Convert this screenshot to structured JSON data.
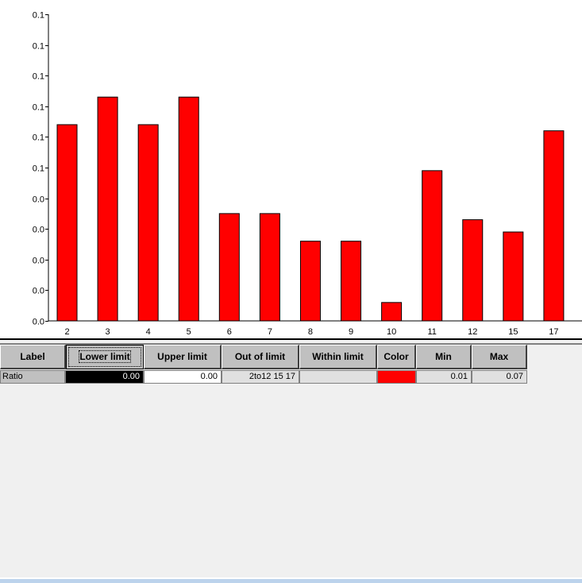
{
  "chart_data": {
    "type": "bar",
    "title": "",
    "xlabel": "",
    "ylabel": "",
    "categories": [
      "2",
      "3",
      "4",
      "5",
      "6",
      "7",
      "8",
      "9",
      "10",
      "11",
      "12",
      "15",
      "17"
    ],
    "values": [
      0.064,
      0.073,
      0.064,
      0.073,
      0.035,
      0.035,
      0.026,
      0.026,
      0.006,
      0.049,
      0.033,
      0.029,
      0.062
    ],
    "ylim": [
      0,
      0.1
    ],
    "y_ticks": [
      0,
      0.01,
      0.02,
      0.03,
      0.04,
      0.05,
      0.06,
      0.07,
      0.08,
      0.09,
      0.1
    ],
    "y_tick_labels": [
      "0.0",
      "0.0",
      "0.0",
      "0.0",
      "0.0",
      "0.1",
      "0.1",
      "0.1",
      "0.1",
      "0.1",
      "0.1"
    ],
    "bar_color": "#ff0000",
    "grid": false,
    "legend": "none"
  },
  "table": {
    "headers": [
      "Label",
      "Lower limit",
      "Upper limit",
      "Out of limit",
      "Within limit",
      "Color",
      "Min",
      "Max"
    ],
    "rows": [
      {
        "label": "Ratio",
        "lower_limit": "0.00",
        "upper_limit": "0.00",
        "out_of_limit": "2to12 15 17",
        "within_limit": "",
        "color": "#ff0000",
        "min": "0.01",
        "max": "0.07"
      }
    ]
  }
}
